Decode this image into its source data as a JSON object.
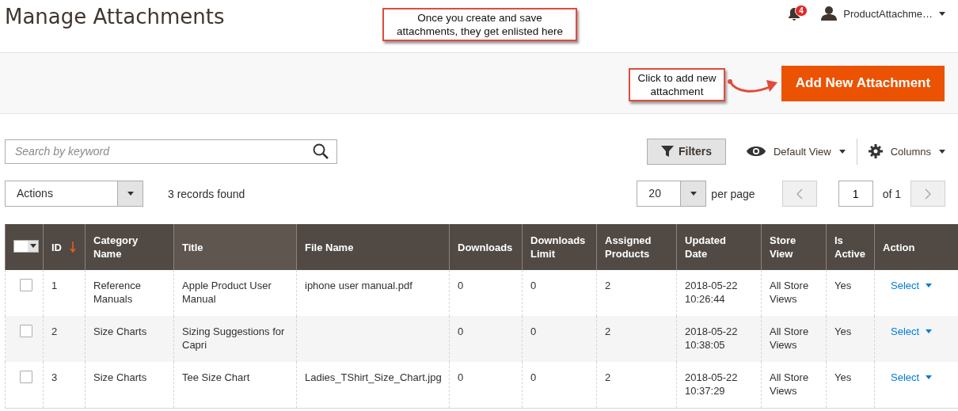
{
  "page_title": "Manage Attachments",
  "notifications": {
    "count": "4"
  },
  "user": {
    "name": "ProductAttachme…"
  },
  "callouts": [
    {
      "text": "Once you create and save attachments, they get enlisted here"
    },
    {
      "text": "Click to add new attachment",
      "arrow": true
    }
  ],
  "add_button": "Add New Attachment",
  "search": {
    "placeholder": "Search by keyword"
  },
  "filters_button": "Filters",
  "view_menu": "Default View",
  "columns_menu": "Columns",
  "actions_select": "Actions",
  "records_found": "3 records found",
  "pager": {
    "page_size": "20",
    "per_page_label": "per page",
    "page": "1",
    "page_count": "of 1"
  },
  "table": {
    "mass_select": {
      "checked": false
    },
    "columns": [
      {
        "label": "ID",
        "sorted": true,
        "highlighted": false
      },
      {
        "label": "Category Name",
        "sorted": false,
        "highlighted": false
      },
      {
        "label": "Title",
        "sorted": false,
        "highlighted": true
      },
      {
        "label": "File Name",
        "sorted": false,
        "highlighted": false
      },
      {
        "label": "Downloads",
        "sorted": false,
        "highlighted": false
      },
      {
        "label": "Downloads Limit",
        "sorted": false,
        "highlighted": false
      },
      {
        "label": "Assigned Products",
        "sorted": false,
        "highlighted": false
      },
      {
        "label": "Updated Date",
        "sorted": false,
        "highlighted": false
      },
      {
        "label": "Store View",
        "sorted": false,
        "highlighted": false
      },
      {
        "label": "Is Active",
        "sorted": false,
        "highlighted": false
      },
      {
        "label": "Action",
        "sorted": false,
        "highlighted": false
      }
    ],
    "rows": [
      {
        "checked": false,
        "cells": [
          "1",
          "Reference Manuals",
          "Apple Product User Manual",
          "iphone user manual.pdf",
          "0",
          "0",
          "2",
          "2018-05-22 10:26:44",
          "All Store Views",
          "Yes"
        ],
        "action": "Select"
      },
      {
        "checked": false,
        "cells": [
          "2",
          "Size Charts",
          "Sizing Suggestions for Capri",
          "",
          "0",
          "0",
          "2",
          "2018-05-22 10:38:05",
          "All Store Views",
          "Yes"
        ],
        "action": "Select"
      },
      {
        "checked": false,
        "cells": [
          "3",
          "Size Charts",
          "Tee Size Chart",
          "Ladies_TShirt_Size_Chart.jpg",
          "0",
          "0",
          "2",
          "2018-05-22 10:37:29",
          "All Store Views",
          "Yes"
        ],
        "action": "Select"
      }
    ]
  }
}
